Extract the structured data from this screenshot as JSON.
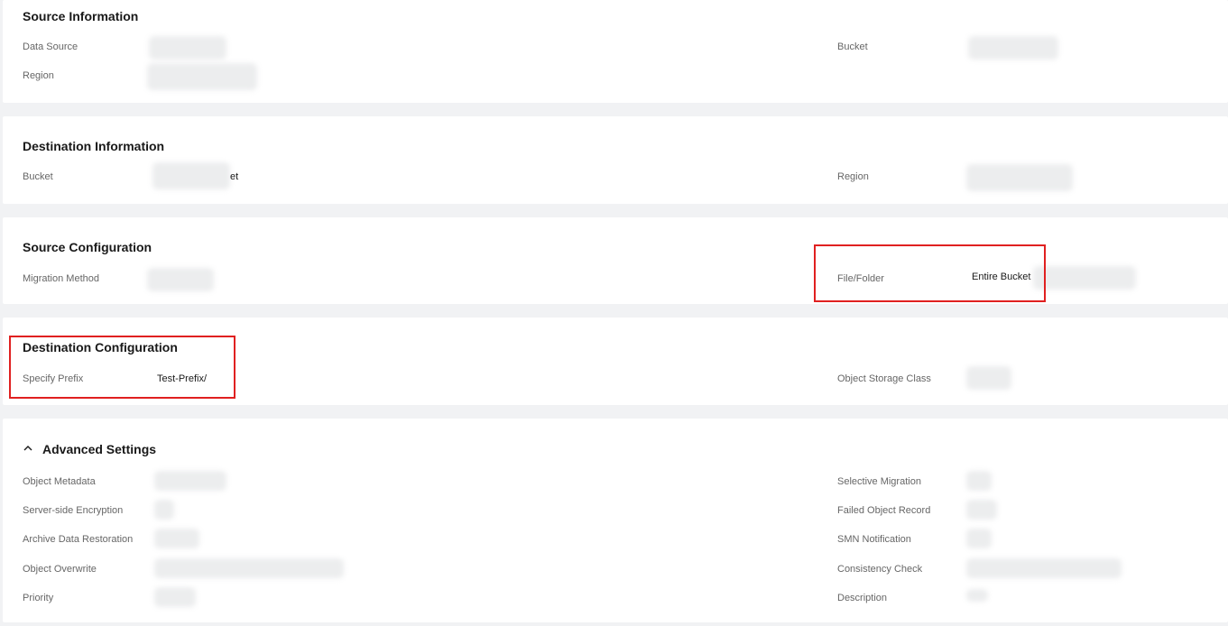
{
  "source_information": {
    "title": "Source Information",
    "data_source_label": "Data Source",
    "region_label": "Region",
    "bucket_label": "Bucket"
  },
  "destination_information": {
    "title": "Destination Information",
    "bucket_label": "Bucket",
    "bucket_value_suffix": "et",
    "region_label": "Region"
  },
  "source_configuration": {
    "title": "Source Configuration",
    "migration_method_label": "Migration Method",
    "file_folder_label": "File/Folder",
    "file_folder_value": "Entire Bucket"
  },
  "destination_configuration": {
    "title": "Destination Configuration",
    "specify_prefix_label": "Specify Prefix",
    "specify_prefix_value": "Test-Prefix/",
    "object_storage_class_label": "Object Storage Class"
  },
  "advanced_settings": {
    "title": "Advanced Settings",
    "icon": "chevron-up-icon",
    "left_labels": [
      "Object Metadata",
      "Server-side Encryption",
      "Archive Data Restoration",
      "Object Overwrite",
      "Priority"
    ],
    "right_labels": [
      "Selective Migration",
      "Failed Object Record",
      "SMN Notification",
      "Consistency Check",
      "Description"
    ]
  },
  "colors": {
    "highlight": "#e02020",
    "page_bg": "#f1f2f4",
    "card_bg": "#ffffff"
  }
}
